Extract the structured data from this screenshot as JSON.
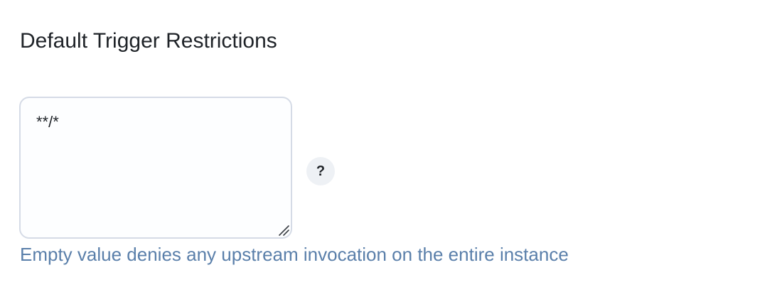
{
  "section": {
    "title": "Default Trigger Restrictions"
  },
  "restrictions_field": {
    "value": "**/*",
    "hint": "Empty value denies any upstream invocation on the entire instance"
  },
  "help_button": {
    "label": "?",
    "icon": "question-mark-icon"
  },
  "colors": {
    "title_text": "#1f2328",
    "hint_text": "#5a7faa",
    "field_border": "#d5dbe6",
    "help_button_bg": "#eef1f5"
  }
}
